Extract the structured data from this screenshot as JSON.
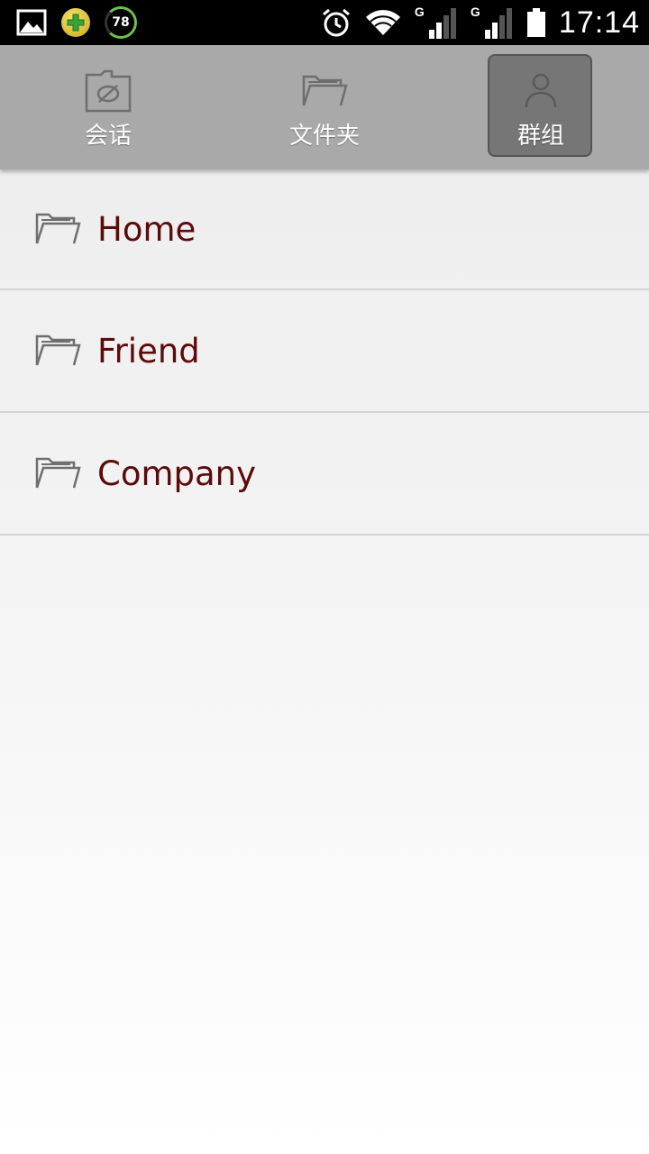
{
  "status_bar": {
    "battery_percent_badge": "78",
    "time": "17:14",
    "network_type_1": "G",
    "network_type_2": "G",
    "icons": [
      "image-icon",
      "plus-badge-icon",
      "battery-ring-icon",
      "alarm-icon",
      "wifi-icon",
      "signal-icon",
      "signal-icon",
      "battery-icon"
    ]
  },
  "tabs": [
    {
      "label": "会话",
      "icon": "chat-folder-icon",
      "active": false
    },
    {
      "label": "文件夹",
      "icon": "folder-icon",
      "active": false
    },
    {
      "label": "群组",
      "icon": "person-icon",
      "active": true
    }
  ],
  "groups": [
    {
      "label": "Home",
      "icon": "folder-icon"
    },
    {
      "label": "Friend",
      "icon": "folder-icon"
    },
    {
      "label": "Company",
      "icon": "folder-icon"
    }
  ],
  "colors": {
    "item_text": "#5c0a0a",
    "tab_bar_bg": "#a9a9a9",
    "active_tab_bg": "#767676",
    "battery_ring": "#6cc24a"
  }
}
